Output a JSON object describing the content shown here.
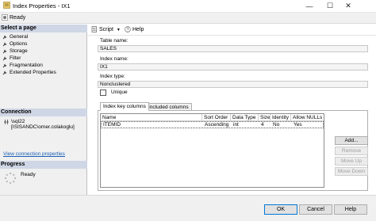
{
  "window": {
    "title": "Index Properties - IX1",
    "minimize_glyph": "—",
    "maximize_glyph": "☐",
    "close_glyph": "✕"
  },
  "status": {
    "text": "Ready"
  },
  "select_page": {
    "header": "Select a page",
    "items": [
      "General",
      "Options",
      "Storage",
      "Filter",
      "Fragmentation",
      "Extended Properties"
    ]
  },
  "connection": {
    "header": "Connection",
    "server": "\\sql22",
    "user": "[ISISANDC\\omer.colakoglu]",
    "link_text": "View connection properties"
  },
  "progress": {
    "header": "Progress",
    "text": "Ready"
  },
  "toolbar": {
    "script_label": "Script",
    "help_label": "Help",
    "dropdown_glyph": "▾"
  },
  "form": {
    "table_name_label": "Table name:",
    "table_name_value": "SALES",
    "index_name_label": "Index name:",
    "index_name_value": "IX1",
    "index_type_label": "Index type:",
    "index_type_value": "Nonclustered",
    "unique_label": "Unique"
  },
  "tabs": [
    "Index key columns",
    "Included columns"
  ],
  "grid": {
    "headers": [
      "Name",
      "Sort Order",
      "Data Type",
      "Size",
      "Identity",
      "Allow NULLs"
    ],
    "rows": [
      [
        "ITEMID",
        "Ascending",
        "int",
        "4",
        "No",
        "Yes"
      ]
    ]
  },
  "side_buttons": {
    "add": "Add...",
    "remove": "Remove",
    "move_up": "Move Up",
    "move_down": "Move Down"
  },
  "footer": {
    "ok": "OK",
    "cancel": "Cancel",
    "help": "Help"
  },
  "colors": {
    "section_header": "#cfd6e5",
    "link": "#1a5fb4",
    "default_button_border": "#0078d7"
  },
  "icons": {
    "title": "index-properties-icon",
    "status": "status-ready-icon",
    "page": "wrench-icon",
    "connection": "server-connection-icon",
    "progress": "progress-spinner-icon",
    "script": "script-icon",
    "help": "help-icon"
  }
}
